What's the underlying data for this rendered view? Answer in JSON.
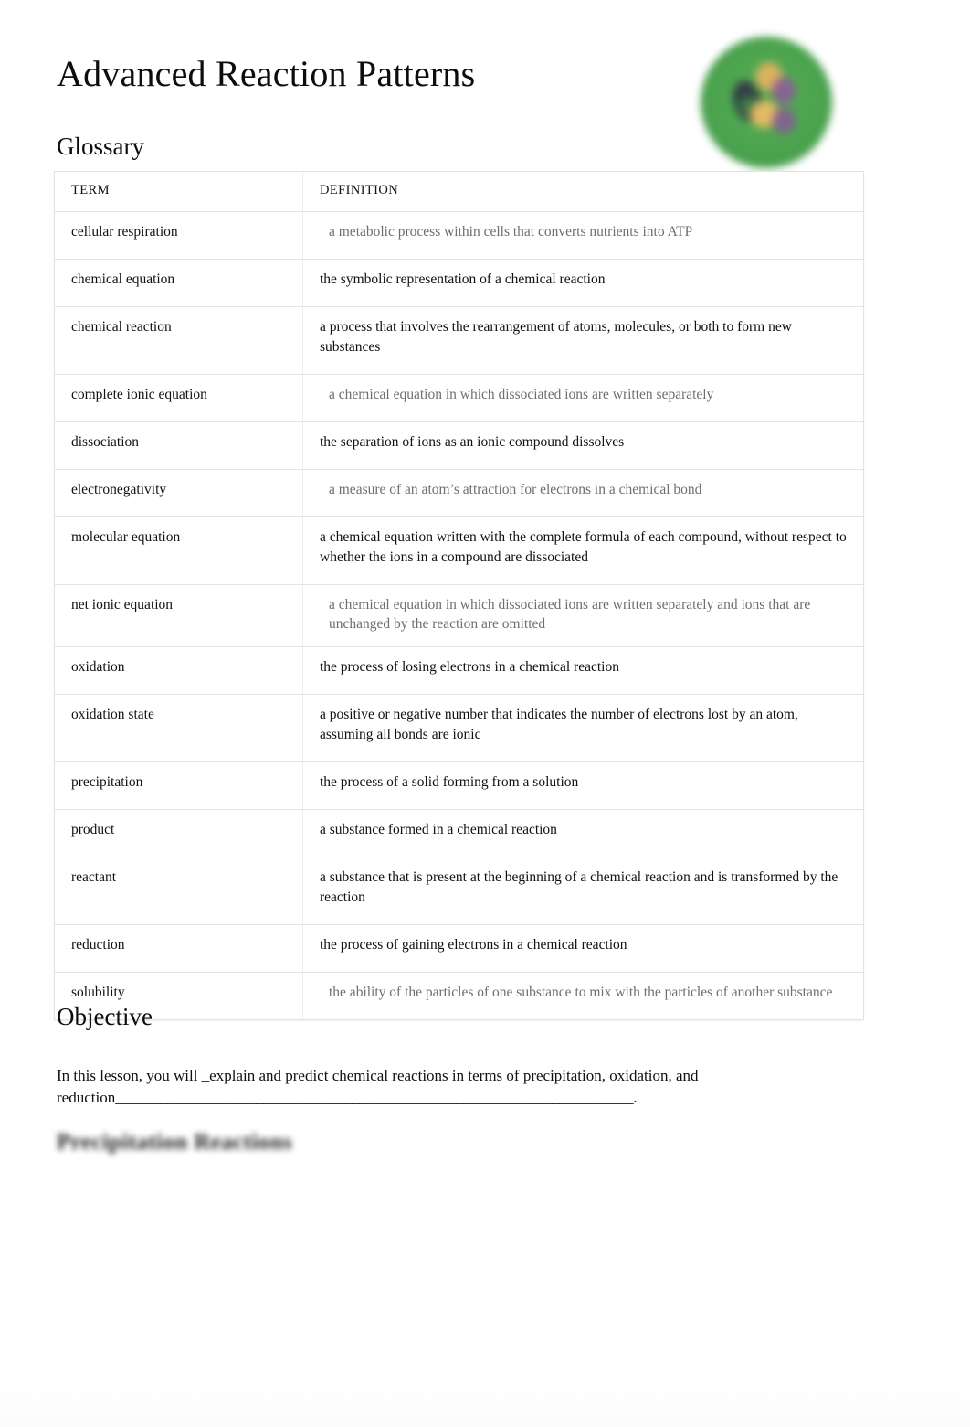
{
  "document": {
    "title": "Advanced Reaction Patterns",
    "logo_icon": "green-circle-molecule-logo"
  },
  "glossary": {
    "heading": "Glossary",
    "columns": {
      "term": "TERM",
      "definition": "DEFINITION"
    },
    "rows": [
      {
        "term": "cellular respiration",
        "definition": "a metabolic process within cells that converts nutrients into ATP",
        "style": "answer"
      },
      {
        "term": "chemical equation",
        "definition": "the symbolic representation of a chemical reaction",
        "style": "given"
      },
      {
        "term": "chemical reaction",
        "definition": "a process that involves the rearrangement of atoms, molecules, or both to form new substances",
        "style": "given"
      },
      {
        "term": "complete ionic equation",
        "definition": "a chemical equation in which dissociated ions are written separately",
        "style": "answer"
      },
      {
        "term": "dissociation",
        "definition": "the separation of ions as an ionic compound dissolves",
        "style": "given"
      },
      {
        "term": "electronegativity",
        "definition": "a measure of an atom’s attraction for electrons in a chemical bond",
        "style": "answer"
      },
      {
        "term": "molecular equation",
        "definition": "a chemical equation written with the complete formula of each compound, without respect to whether the ions in a compound are dissociated",
        "style": "given"
      },
      {
        "term": "net ionic equation",
        "definition": "a chemical equation in which dissociated ions are written separately and   ions that are unchanged by the reaction are omitted",
        "style": "answer"
      },
      {
        "term": "oxidation",
        "definition": "the process of losing electrons in a chemical reaction",
        "style": "given"
      },
      {
        "term": "oxidation state",
        "definition": "a positive or negative number that indicates the number of electrons lost by an atom, assuming all bonds are ionic",
        "style": "given"
      },
      {
        "term": "precipitation",
        "definition": "the process of a solid forming from a solution",
        "style": "given"
      },
      {
        "term": "product",
        "definition": "a substance formed in a chemical reaction",
        "style": "given"
      },
      {
        "term": "reactant",
        "definition": "a substance that is present at the beginning of a chemical reaction and is transformed by the reaction",
        "style": "given"
      },
      {
        "term": "reduction",
        "definition": "the process of gaining electrons in a chemical reaction",
        "style": "given"
      },
      {
        "term": "solubility",
        "definition": "the ability of the particles of one substance to mix with the particles of   another substance",
        "style": "answer"
      }
    ]
  },
  "objective": {
    "heading": "Objective",
    "lead": "In this lesson, you will ",
    "filled_answer": "_explain and predict chemical reactions in terms of precipitation, oxidation, and reduction",
    "blank": "______________________________________________________________________",
    "terminator": "."
  },
  "sections": {
    "precipitation_heading": "Precipitation Reactions"
  },
  "colors": {
    "text": "#101010",
    "answer_text": "#6e6e6e",
    "table_border": "#e4e4e4",
    "logo_green": "#48a24a"
  }
}
